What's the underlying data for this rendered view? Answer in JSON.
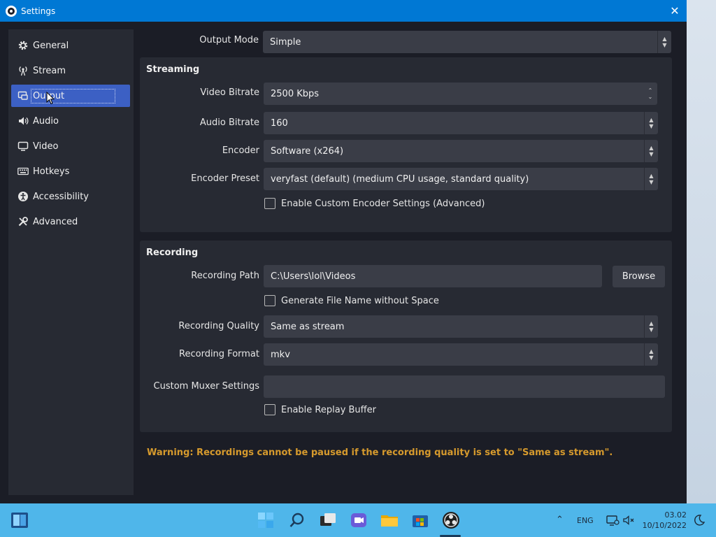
{
  "window": {
    "title": "Settings"
  },
  "sidebar": {
    "items": [
      {
        "label": "General"
      },
      {
        "label": "Stream"
      },
      {
        "label": "Output"
      },
      {
        "label": "Audio"
      },
      {
        "label": "Video"
      },
      {
        "label": "Hotkeys"
      },
      {
        "label": "Accessibility"
      },
      {
        "label": "Advanced"
      }
    ],
    "active": "Output"
  },
  "output_mode": {
    "label": "Output Mode",
    "value": "Simple"
  },
  "streaming": {
    "title": "Streaming",
    "video_bitrate": {
      "label": "Video Bitrate",
      "value": "2500 Kbps"
    },
    "audio_bitrate": {
      "label": "Audio Bitrate",
      "value": "160"
    },
    "encoder": {
      "label": "Encoder",
      "value": "Software (x264)"
    },
    "encoder_preset": {
      "label": "Encoder Preset",
      "value": "veryfast (default) (medium CPU usage, standard quality)"
    },
    "custom_encoder_checkbox": "Enable Custom Encoder Settings (Advanced)"
  },
  "recording": {
    "title": "Recording",
    "path": {
      "label": "Recording Path",
      "value": "C:\\Users\\lol\\Videos"
    },
    "browse_label": "Browse",
    "no_space_checkbox": "Generate File Name without Space",
    "quality": {
      "label": "Recording Quality",
      "value": "Same as stream"
    },
    "format": {
      "label": "Recording Format",
      "value": "mkv"
    },
    "muxer": {
      "label": "Custom Muxer Settings",
      "value": ""
    },
    "replay_buffer_checkbox": "Enable Replay Buffer"
  },
  "warning": "Warning: Recordings cannot be paused if the recording quality is set to \"Same as stream\".",
  "taskbar": {
    "language": "ENG",
    "time": "03.02",
    "date": "10/10/2022"
  },
  "colors": {
    "accent": "#3c60c4",
    "titlebar": "#0078d4",
    "warning": "#d69a2d",
    "taskbar": "#4fb6ea"
  }
}
